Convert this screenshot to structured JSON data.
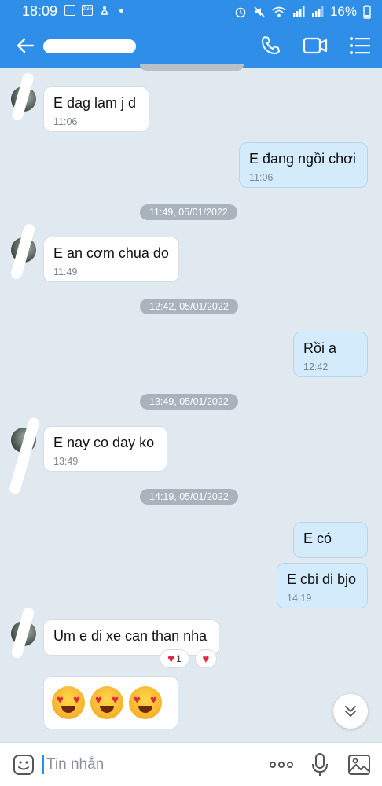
{
  "status_bar": {
    "time": "18:09",
    "battery": "16%",
    "zalo_label": "Zalo"
  },
  "header": {
    "contact_name": ""
  },
  "date_separators": [
    "11:49, 05/01/2022",
    "12:42, 05/01/2022",
    "13:49, 05/01/2022",
    "14:19, 05/01/2022"
  ],
  "messages": [
    {
      "text": "E dag lam j d",
      "time": "11:06"
    },
    {
      "text": "E đang ngồi chơi",
      "time": "11:06"
    },
    {
      "text": "E an cơm chua do",
      "time": "11:49"
    },
    {
      "text": "Rồi a",
      "time": "12:42"
    },
    {
      "text": "E nay co day ko",
      "time": "13:49"
    },
    {
      "text": "E có",
      "time": ""
    },
    {
      "text": "E cbi di bjo",
      "time": "14:19"
    },
    {
      "text": "Um e di xe can than nha",
      "time": ""
    }
  ],
  "reactions": {
    "count": "1"
  },
  "composer": {
    "placeholder": "Tin nhắn"
  },
  "colors": {
    "header": "#2f8fe8",
    "outgoing": "#d4ebfb",
    "incoming": "#ffffff",
    "background": "#e1e9f0"
  },
  "icons": [
    "back-arrow",
    "phone",
    "video-camera",
    "list-menu",
    "sticker",
    "more",
    "microphone",
    "image",
    "chevron-double-down",
    "heart"
  ]
}
